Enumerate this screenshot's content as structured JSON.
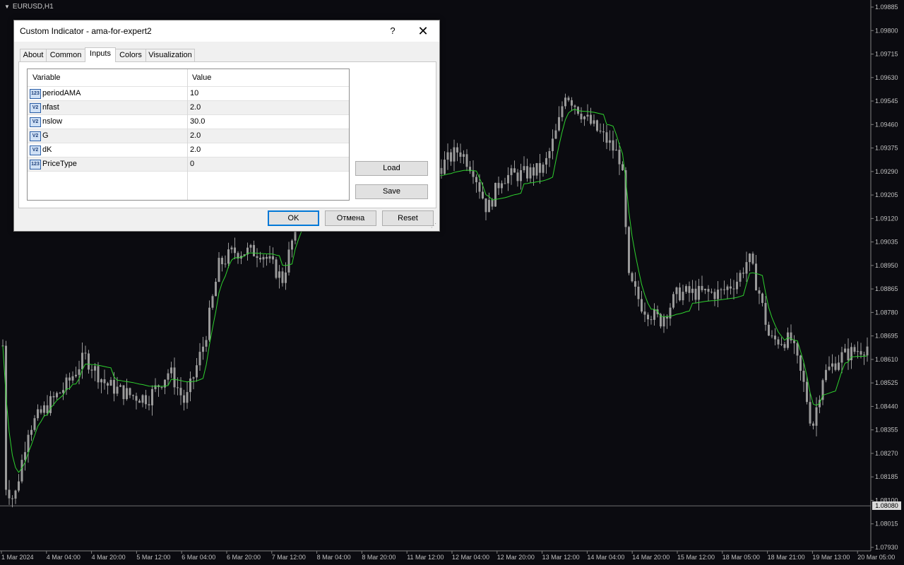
{
  "chart": {
    "symbol": "EURUSD,H1",
    "current_price": "1.08080",
    "price_labels": [
      "1.09885",
      "1.09800",
      "1.09715",
      "1.09630",
      "1.09545",
      "1.09460",
      "1.09375",
      "1.09290",
      "1.09205",
      "1.09120",
      "1.09035",
      "1.08950",
      "1.08865",
      "1.08780",
      "1.08695",
      "1.08610",
      "1.08525",
      "1.08440",
      "1.08355",
      "1.08270",
      "1.08185",
      "1.08100",
      "1.08015",
      "1.07930"
    ],
    "time_labels": [
      "1 Mar 2024",
      "4 Mar 04:00",
      "4 Mar 20:00",
      "5 Mar 12:00",
      "6 Mar 04:00",
      "6 Mar 20:00",
      "7 Mar 12:00",
      "8 Mar 04:00",
      "8 Mar 20:00",
      "11 Mar 12:00",
      "12 Mar 04:00",
      "12 Mar 20:00",
      "13 Mar 12:00",
      "14 Mar 04:00",
      "14 Mar 20:00",
      "15 Mar 12:00",
      "18 Mar 05:00",
      "18 Mar 21:00",
      "19 Mar 13:00",
      "20 Mar 05:00"
    ],
    "colors": {
      "background": "#0b0b10",
      "candle": "#9a9a9a",
      "ama_line": "#2ed12e",
      "axis_text": "#c0c0c0",
      "current_line": "#6e6e6e"
    }
  },
  "dialog": {
    "title": "Custom Indicator - ama-for-expert2",
    "help_label": "?",
    "close_label": "✕",
    "tabs": [
      {
        "label": "About"
      },
      {
        "label": "Common"
      },
      {
        "label": "Inputs"
      },
      {
        "label": "Colors"
      },
      {
        "label": "Visualization"
      }
    ],
    "active_tab": "Inputs",
    "table": {
      "headers": [
        "Variable",
        "Value"
      ],
      "rows": [
        {
          "icon": "123",
          "variable": "periodAMA",
          "value": "10"
        },
        {
          "icon": "V2",
          "variable": "nfast",
          "value": "2.0"
        },
        {
          "icon": "V2",
          "variable": "nslow",
          "value": "30.0"
        },
        {
          "icon": "V2",
          "variable": "G",
          "value": "2.0"
        },
        {
          "icon": "V2",
          "variable": "dK",
          "value": "2.0"
        },
        {
          "icon": "123",
          "variable": "PriceType",
          "value": "0"
        }
      ]
    },
    "side_buttons": {
      "load": "Load",
      "save": "Save"
    },
    "footer_buttons": {
      "ok": "OK",
      "cancel": "Отмена",
      "reset": "Reset"
    }
  }
}
